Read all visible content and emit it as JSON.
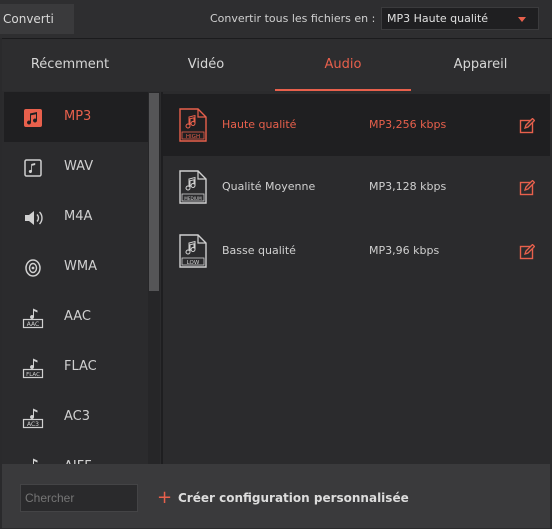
{
  "topbar": {
    "tab_label": "Converti",
    "convert_all_label": "Convertir tous les fichiers en :",
    "selected_format": "MP3 Haute qualité"
  },
  "tabs": [
    {
      "label": "Récemment",
      "active": false
    },
    {
      "label": "Vidéo",
      "active": false
    },
    {
      "label": "Audio",
      "active": true
    },
    {
      "label": "Appareil",
      "active": false
    }
  ],
  "formats": [
    {
      "label": "MP3",
      "icon": "music-note-icon",
      "active": true
    },
    {
      "label": "WAV",
      "icon": "music-file-icon",
      "active": false
    },
    {
      "label": "M4A",
      "icon": "speaker-icon",
      "active": false
    },
    {
      "label": "WMA",
      "icon": "wma-speaker-icon",
      "active": false
    },
    {
      "label": "AAC",
      "icon": "aac-file-icon",
      "badge": "AAC",
      "active": false
    },
    {
      "label": "FLAC",
      "icon": "flac-file-icon",
      "badge": "FLAC",
      "active": false
    },
    {
      "label": "AC3",
      "icon": "ac3-file-icon",
      "badge": "AC3",
      "active": false
    },
    {
      "label": "AIFF",
      "icon": "aiff-file-icon",
      "active": false
    }
  ],
  "presets": [
    {
      "name": "Haute qualité",
      "spec": "MP3,256 kbps",
      "badge": "HIGH",
      "active": true
    },
    {
      "name": "Qualité Moyenne",
      "spec": "MP3,128 kbps",
      "badge": "MEDIUM",
      "active": false
    },
    {
      "name": "Basse qualité",
      "spec": "MP3,96 kbps",
      "badge": "LOW",
      "active": false
    }
  ],
  "bottom": {
    "search_placeholder": "Chercher",
    "create_label": "Créer configuration personnalisée"
  },
  "colors": {
    "accent": "#e8604c",
    "background": "#2b2b2d",
    "selected_row": "#1f1f21"
  }
}
